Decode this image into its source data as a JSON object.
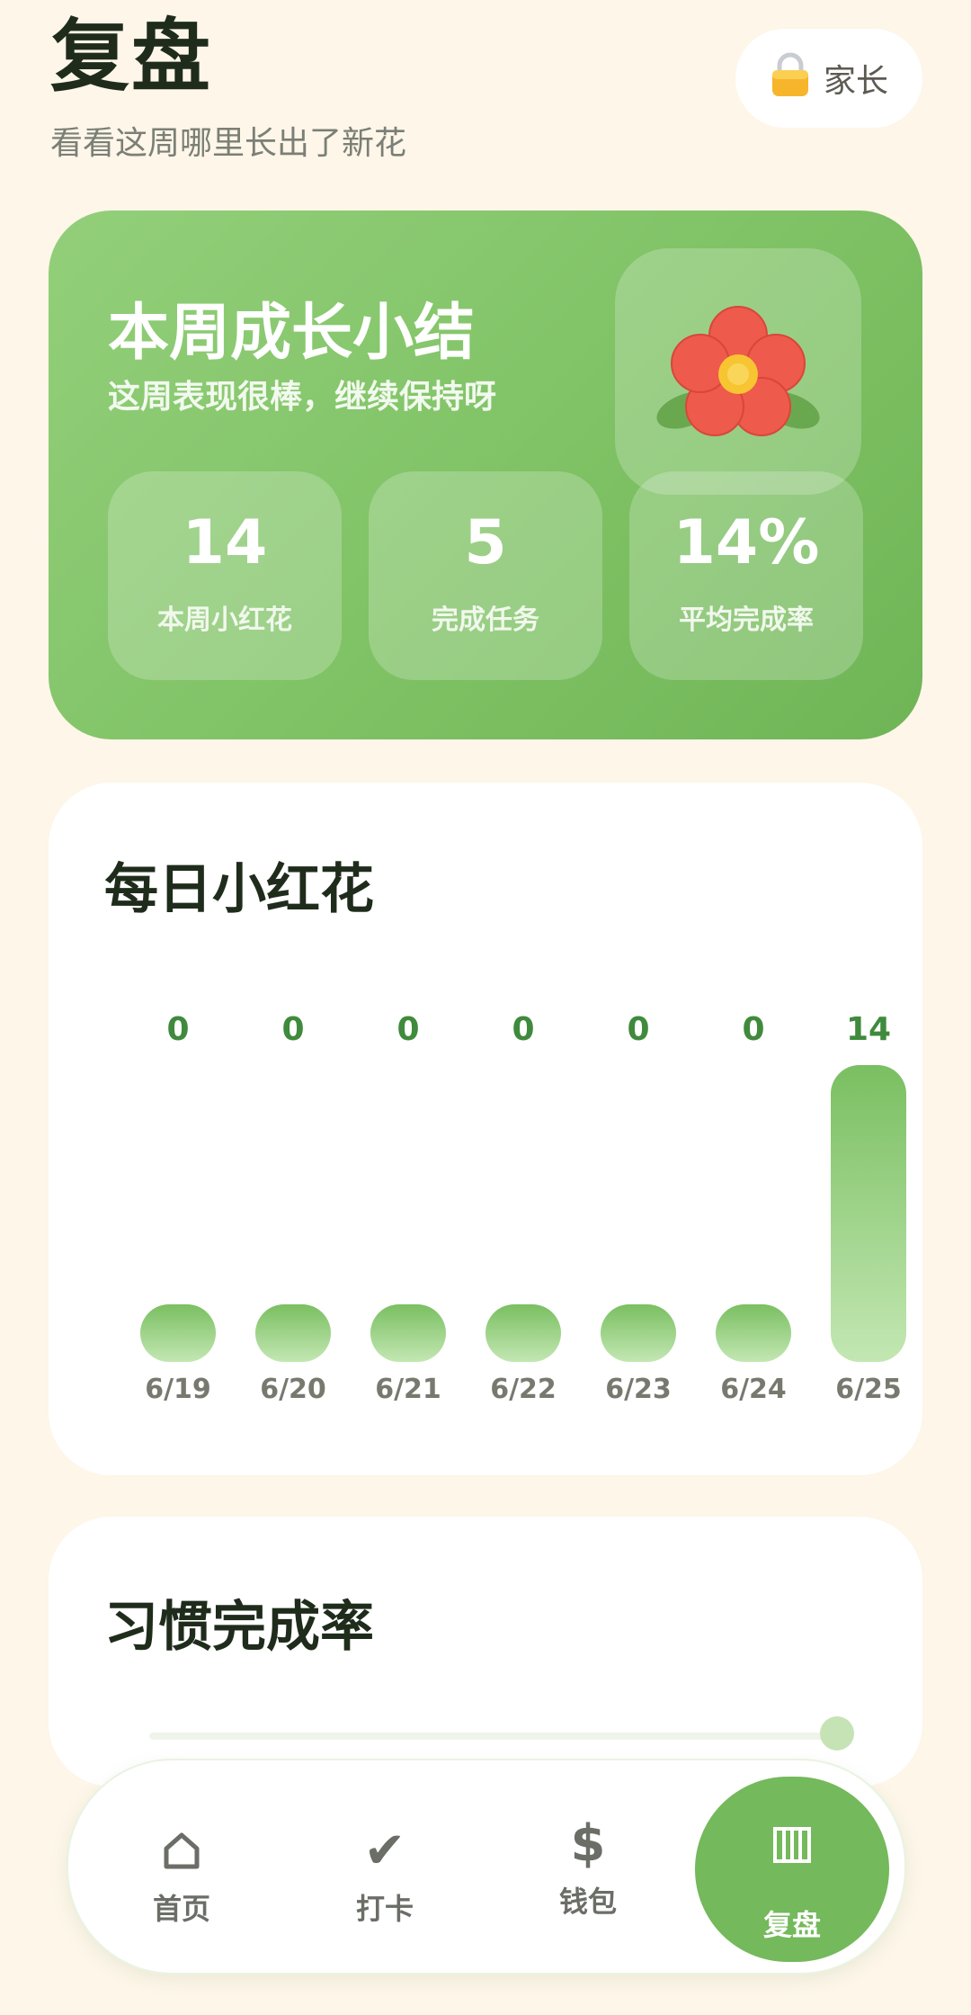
{
  "header": {
    "title": "复盘",
    "subtitle": "看看这周哪里长出了新花",
    "parent_button": {
      "label": "家长",
      "icon": "lock-icon"
    }
  },
  "summary": {
    "title": "本周成长小结",
    "subtitle": "这周表现很棒，继续保持呀",
    "flower_icon": "red-flower-icon",
    "stats": [
      {
        "value": "14",
        "label": "本周小红花"
      },
      {
        "value": "5",
        "label": "完成任务"
      },
      {
        "value": "14%",
        "label": "平均完成率"
      }
    ]
  },
  "daily": {
    "title": "每日小红花",
    "chart_data": {
      "type": "bar",
      "categories": [
        "6/19",
        "6/20",
        "6/21",
        "6/22",
        "6/23",
        "6/24",
        "6/25"
      ],
      "values": [
        0,
        0,
        0,
        0,
        0,
        0,
        14
      ],
      "bar_color_top": "#7abf61",
      "bar_color_bottom": "#c3e7b3",
      "label_color": "#3f8a3c"
    }
  },
  "habit": {
    "title": "习惯完成率",
    "progress": 1.0
  },
  "nav": {
    "items": [
      {
        "label": "首页",
        "icon": "home-icon"
      },
      {
        "label": "打卡",
        "icon": "check-icon"
      },
      {
        "label": "钱包",
        "icon": "dollar-icon"
      },
      {
        "label": "复盘",
        "icon": "review-bars-icon",
        "active": true
      }
    ]
  },
  "colors": {
    "background": "#fdf6e9",
    "accent": "#74b95b",
    "card": "#ffffff"
  }
}
